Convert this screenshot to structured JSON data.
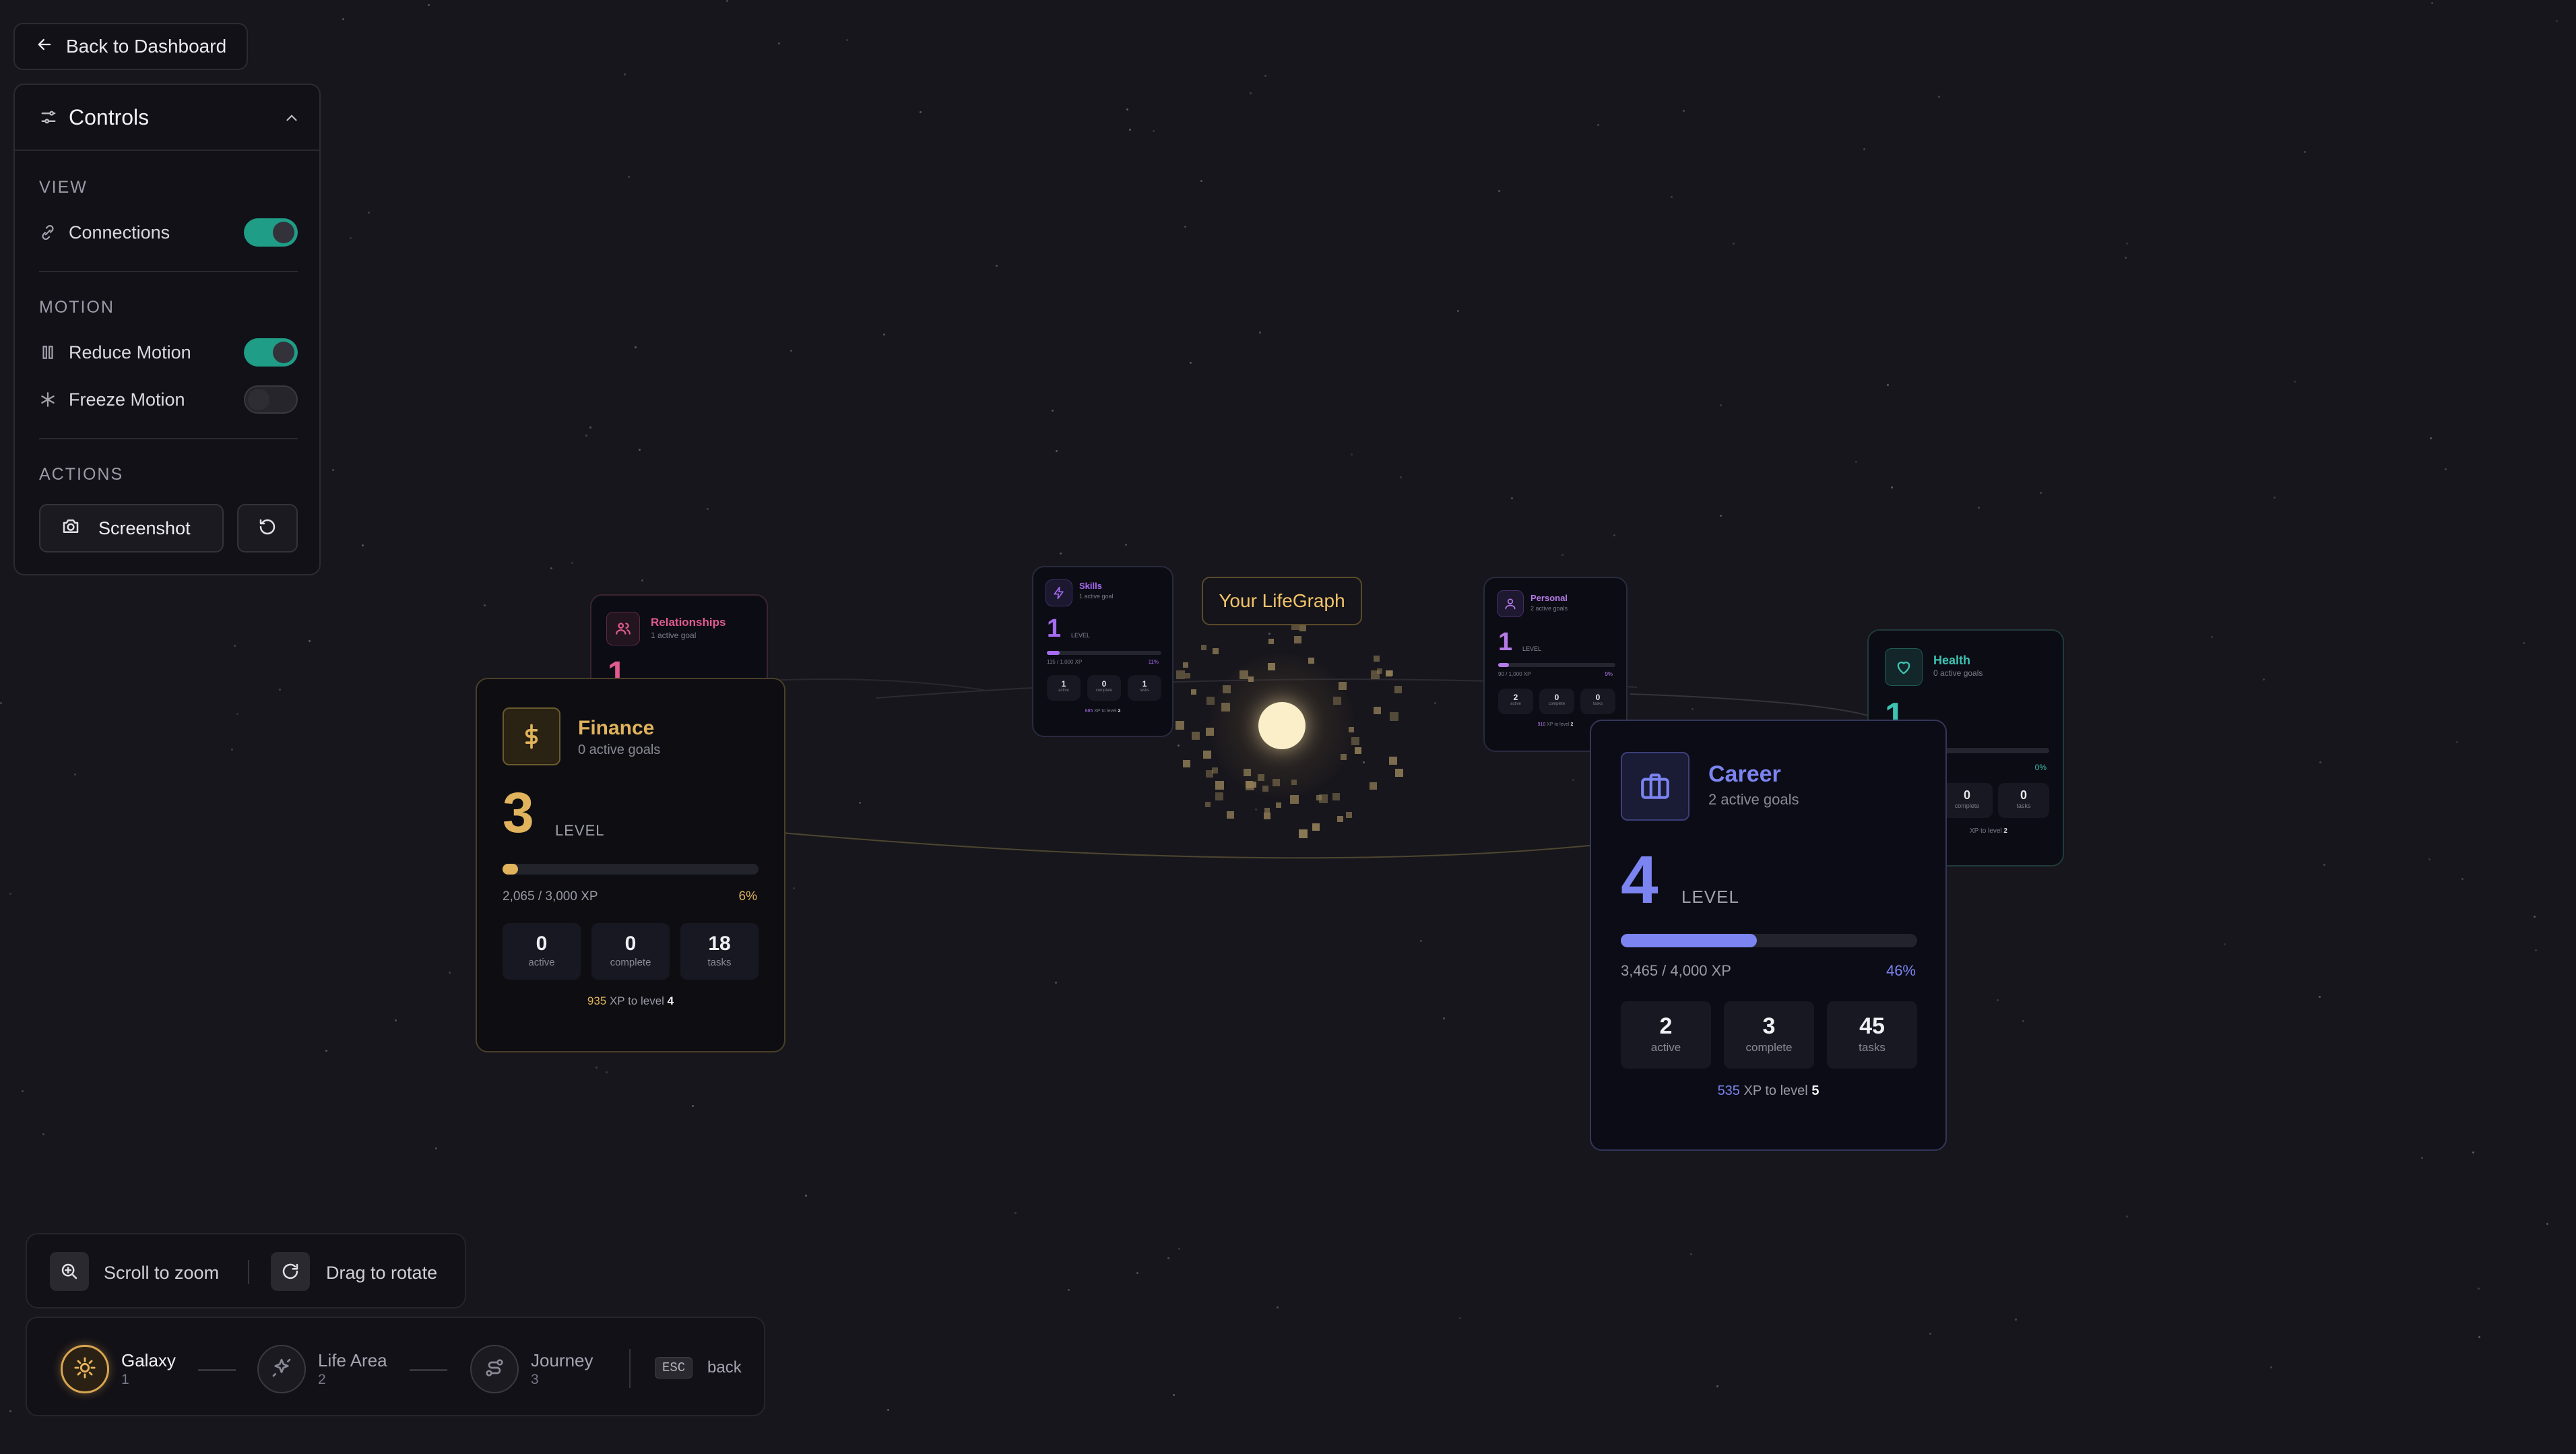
{
  "nav_back": {
    "label": "Back to Dashboard"
  },
  "controls": {
    "title": "Controls",
    "view_label": "VIEW",
    "connections_label": "Connections",
    "connections_on": true,
    "motion_label": "MOTION",
    "reduce_motion_label": "Reduce Motion",
    "reduce_motion_on": true,
    "freeze_motion_label": "Freeze Motion",
    "freeze_motion_on": false,
    "actions_label": "ACTIONS",
    "screenshot_label": "Screenshot"
  },
  "center": {
    "label": "Your LifeGraph"
  },
  "cards": {
    "finance": {
      "name": "Finance",
      "subtitle": "0 active goals",
      "level": "3",
      "level_label": "LEVEL",
      "xp": "2,065 / 3,000 XP",
      "pct": "6%",
      "progress": 0.06,
      "active": "0",
      "active_label": "active",
      "complete": "0",
      "complete_label": "complete",
      "tasks": "18",
      "tasks_label": "tasks",
      "xp_to": "935",
      "xp_to_text": "XP to level",
      "next_level": "4",
      "accent": "#e0b35c"
    },
    "career": {
      "name": "Career",
      "subtitle": "2 active goals",
      "level": "4",
      "level_label": "LEVEL",
      "xp": "3,465 / 4,000 XP",
      "pct": "46%",
      "progress": 0.46,
      "active": "2",
      "active_label": "active",
      "complete": "3",
      "complete_label": "complete",
      "tasks": "45",
      "tasks_label": "tasks",
      "xp_to": "535",
      "xp_to_text": "XP to level",
      "next_level": "5",
      "accent": "#7b84f0"
    },
    "relationships": {
      "name": "Relationships",
      "subtitle": "1 active goal",
      "level": "1",
      "accent": "#e25b8f"
    },
    "skills": {
      "name": "Skills",
      "subtitle": "1 active goal",
      "level": "1",
      "level_label": "LEVEL",
      "xp": "115 / 1,000 XP",
      "pct": "11%",
      "progress": 0.11,
      "active": "1",
      "complete": "0",
      "tasks": "1",
      "active_label": "active",
      "complete_label": "complete",
      "tasks_label": "tasks",
      "xp_to": "885",
      "xp_to_text": "XP to level",
      "next_level": "2",
      "accent": "#a56bf0"
    },
    "personal": {
      "name": "Personal",
      "subtitle": "2 active goals",
      "level": "1",
      "level_label": "LEVEL",
      "xp": "90 / 1,000 XP",
      "pct": "9%",
      "progress": 0.09,
      "active": "2",
      "complete": "0",
      "tasks": "0",
      "active_label": "active",
      "complete_label": "complete",
      "tasks_label": "tasks",
      "xp_to": "910",
      "xp_to_text": "XP to level",
      "next_level": "2",
      "accent": "#b77be8"
    },
    "health": {
      "name": "Health",
      "subtitle": "0 active goals",
      "level": "1",
      "pct": "0%",
      "progress": 0.0,
      "complete": "0",
      "tasks": "0",
      "complete_label": "complete",
      "tasks_label": "tasks",
      "xp_to_text": "XP to level",
      "next_level": "2",
      "accent": "#3cc3b3"
    }
  },
  "hints": {
    "zoom": "Scroll to zoom",
    "rotate": "Drag to rotate"
  },
  "navigation": {
    "galaxy": "Galaxy",
    "galaxy_num": "1",
    "life_area": "Life Area",
    "life_area_num": "2",
    "journey": "Journey",
    "journey_num": "3",
    "esc_key": "ESC",
    "esc_text": "back"
  }
}
